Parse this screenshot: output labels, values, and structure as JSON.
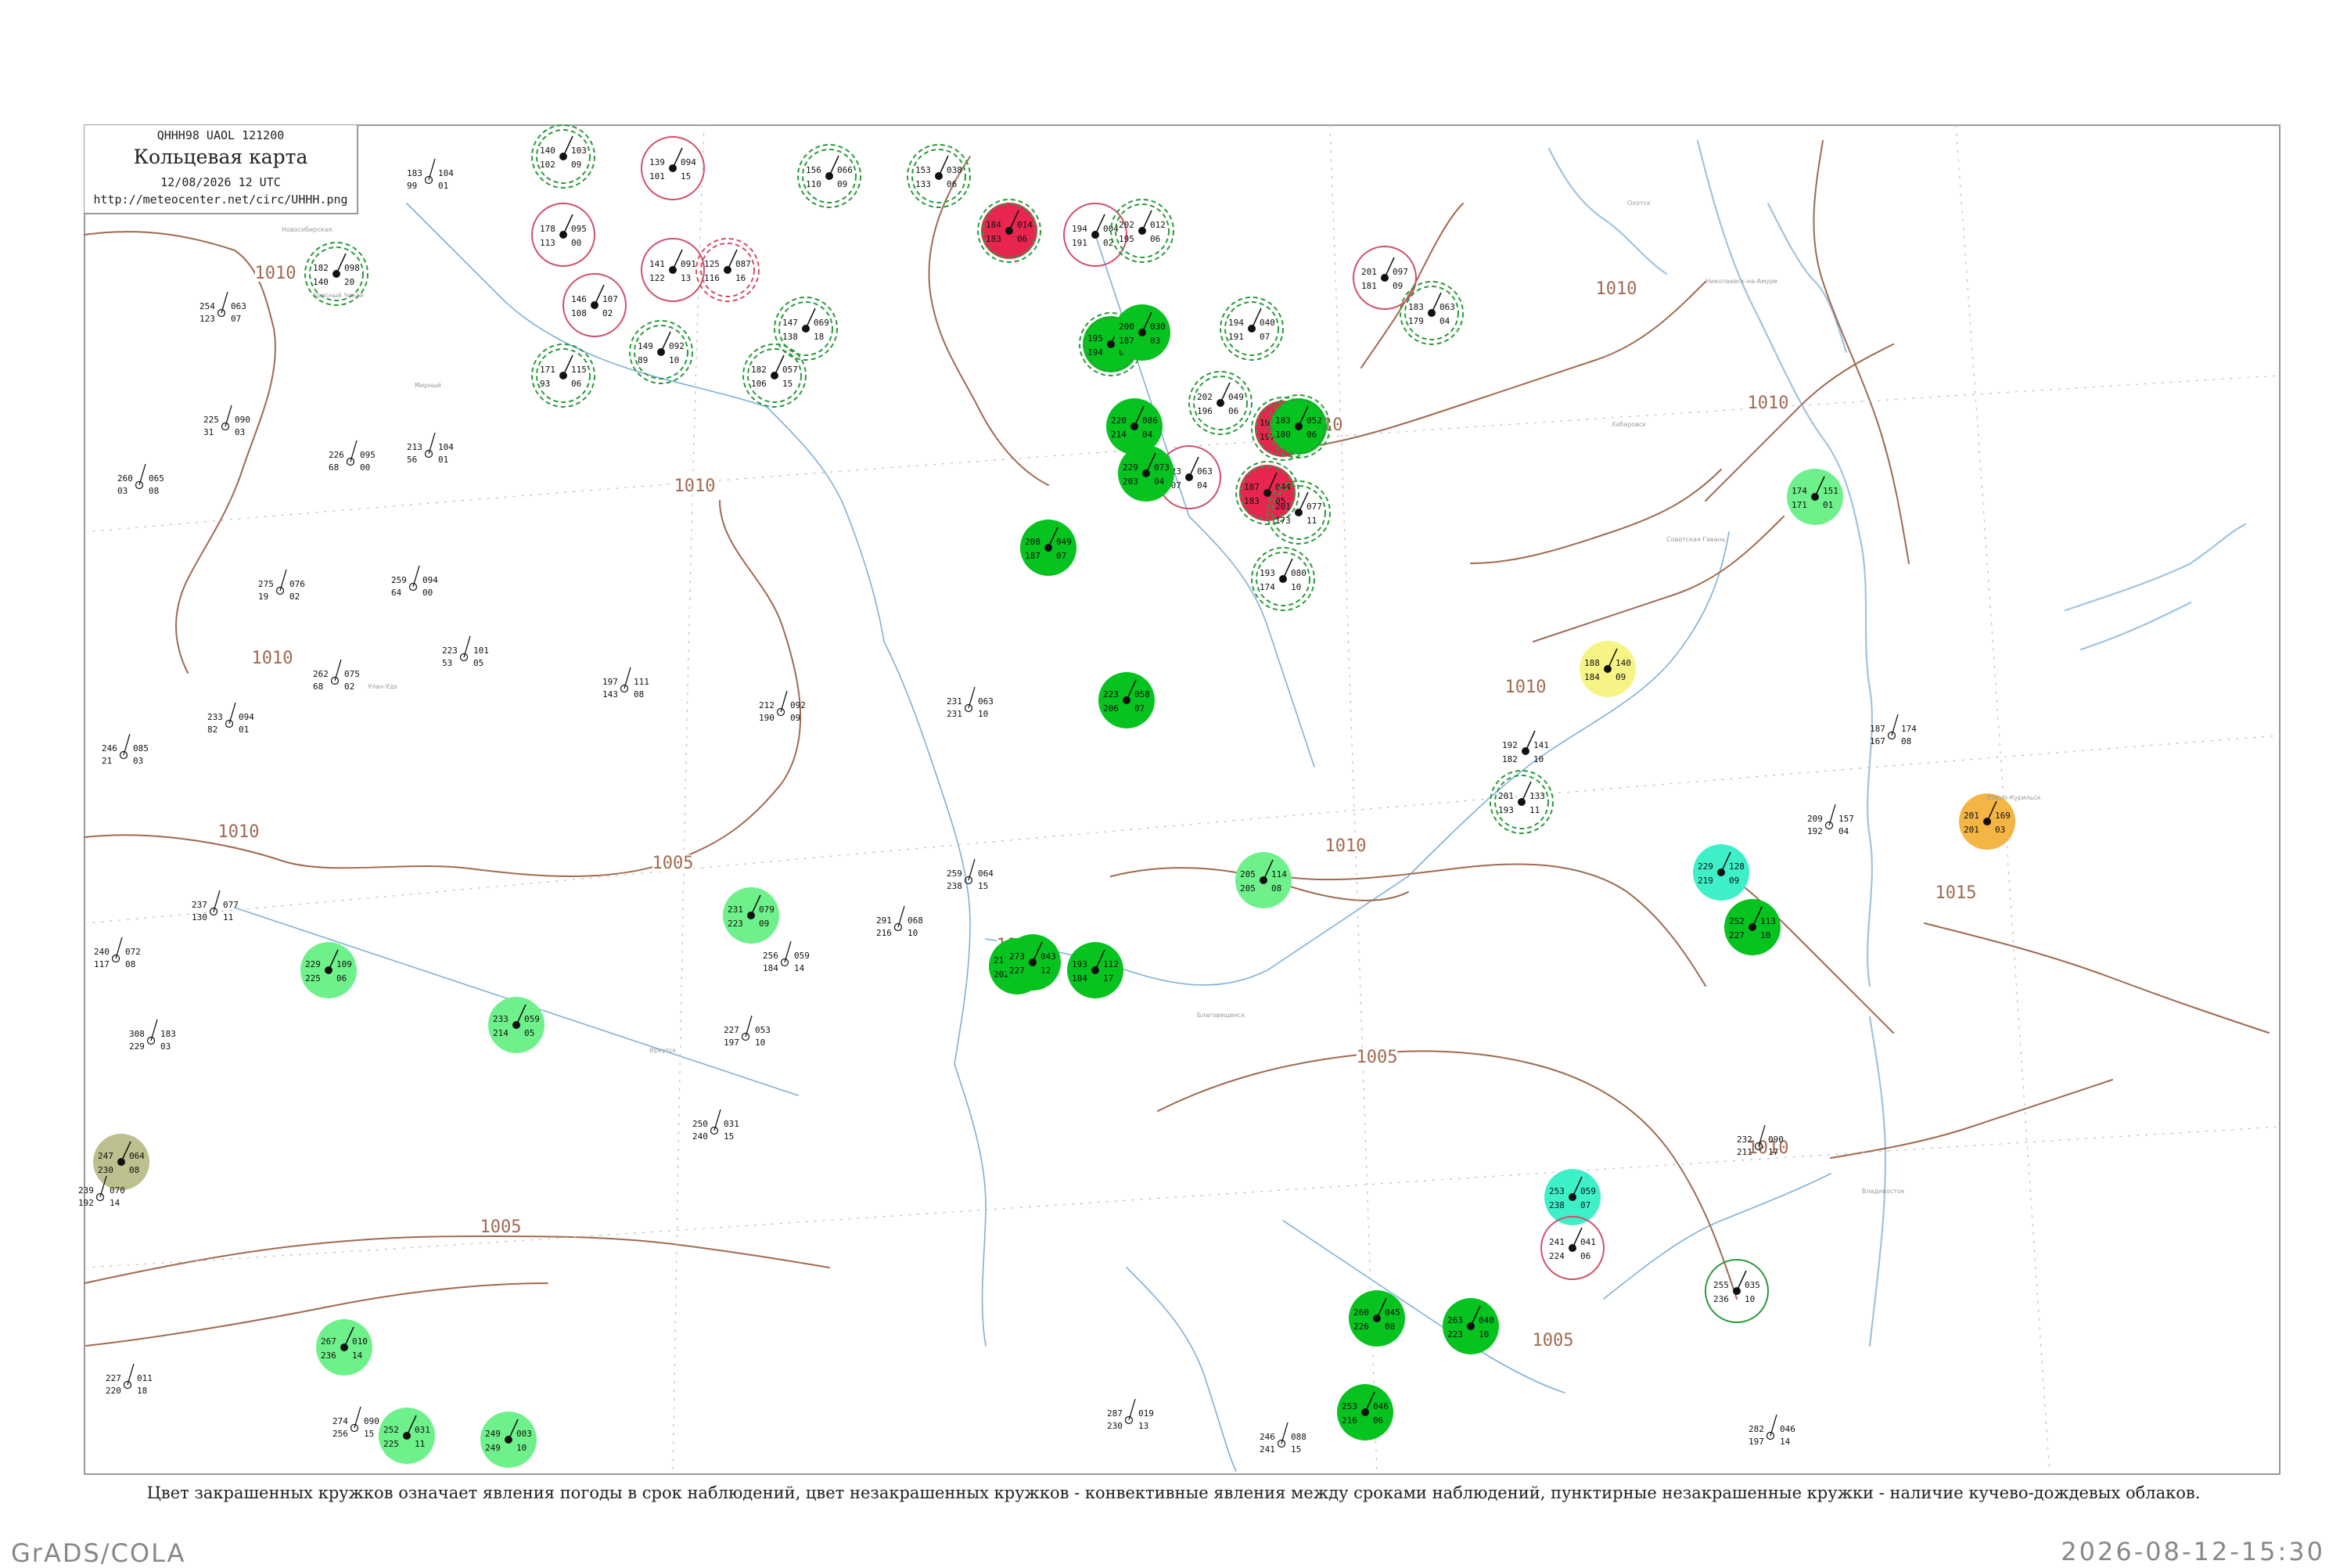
{
  "header": {
    "code": "QHHH98  UAOL  121200",
    "title": "Кольцевая карта",
    "datetime": "12/08/2026 12 UTC",
    "url": "http://meteocenter.net/circ/UHHH.png"
  },
  "caption": "Цвет закрашенных кружков означает явления погоды в срок наблюдений, цвет незакрашенных кружков - конвективные явления между сроками наблюдений, пунктирные незакрашенные кружки - наличие кучево-дождевых облаков.",
  "footer": {
    "left": "GrADS/COLA",
    "right": "2026-08-12-15:30"
  },
  "colors": {
    "precip_rain": "#06c31f",
    "precip_light": "#6ef08a",
    "thunder": "#e8254f",
    "fog": "#f7f486",
    "haze": "#f4b545",
    "drizzle_cyan": "#3ef0c8",
    "dust": "#bdbf8f",
    "isobar": "#a06a50",
    "river": "#7fb0d8",
    "coast": "#9fc4e0"
  },
  "isobars": [
    {
      "label": "1010"
    },
    {
      "label": "1010"
    },
    {
      "label": "1010"
    },
    {
      "label": "1010"
    },
    {
      "label": "1005"
    },
    {
      "label": "1005"
    },
    {
      "label": "1005"
    },
    {
      "label": "1010"
    },
    {
      "label": "1010"
    },
    {
      "label": "1010"
    },
    {
      "label": "1010"
    },
    {
      "label": "1010"
    },
    {
      "label": "1005"
    },
    {
      "label": "1010"
    },
    {
      "label": "1015"
    },
    {
      "label": "1005"
    }
  ],
  "stations": [
    {
      "temp": "182",
      "press": "098",
      "dew": "140",
      "tend": "20",
      "fill": "none",
      "ring": "green-dash"
    },
    {
      "temp": "140",
      "press": "103",
      "dew": "102",
      "tend": "09",
      "fill": "none",
      "ring": "green-dash"
    },
    {
      "temp": "178",
      "press": "095",
      "dew": "113",
      "tend": "00",
      "fill": "none",
      "ring": "red-solid"
    },
    {
      "temp": "139",
      "press": "094",
      "dew": "101",
      "tend": "15",
      "fill": "none",
      "ring": "red-solid"
    },
    {
      "temp": "146",
      "press": "107",
      "dew": "108",
      "tend": "02",
      "fill": "none",
      "ring": "red-solid"
    },
    {
      "temp": "141",
      "press": "091",
      "dew": "122",
      "tend": "13",
      "fill": "none",
      "ring": "red-solid"
    },
    {
      "temp": "125",
      "press": "087",
      "dew": "116",
      "tend": "16",
      "fill": "none",
      "ring": "red-dash"
    },
    {
      "temp": "171",
      "press": "115",
      "dew": "93",
      "tend": "06",
      "fill": "none",
      "ring": "green-dash"
    },
    {
      "temp": "149",
      "press": "092",
      "dew": "89",
      "tend": "10",
      "fill": "none",
      "ring": "green-dash"
    },
    {
      "temp": "147",
      "press": "069",
      "dew": "138",
      "tend": "18",
      "fill": "none",
      "ring": "green-dash"
    },
    {
      "temp": "182",
      "press": "057",
      "dew": "106",
      "tend": "15",
      "fill": "none",
      "ring": "green-dash"
    },
    {
      "temp": "156",
      "press": "066",
      "dew": "110",
      "tend": "09",
      "fill": "none",
      "ring": "green-dash"
    },
    {
      "temp": "153",
      "press": "038",
      "dew": "133",
      "tend": "06",
      "fill": "none",
      "ring": "green-dash"
    },
    {
      "temp": "184",
      "press": "014",
      "dew": "183",
      "tend": "06",
      "fill": "thunder",
      "ring": "green-dash"
    },
    {
      "temp": "194",
      "press": "004",
      "dew": "191",
      "tend": "02",
      "fill": "none",
      "ring": "red-solid"
    },
    {
      "temp": "202",
      "press": "012",
      "dew": "195",
      "tend": "06",
      "fill": "none",
      "ring": "green-dash"
    },
    {
      "temp": "195",
      "press": "036",
      "dew": "194",
      "tend": "07",
      "fill": "precip_rain",
      "ring": "green-dash"
    },
    {
      "temp": "200",
      "press": "030",
      "dew": "187",
      "tend": "03",
      "fill": "precip_rain",
      "ring": "none"
    },
    {
      "temp": "194",
      "press": "040",
      "dew": "191",
      "tend": "07",
      "fill": "none",
      "ring": "green-dash"
    },
    {
      "temp": "201",
      "press": "097",
      "dew": "181",
      "tend": "09",
      "fill": "none",
      "ring": "red-solid"
    },
    {
      "temp": "183",
      "press": "063",
      "dew": "179",
      "tend": "04",
      "fill": "none",
      "ring": "green-dash"
    },
    {
      "temp": "202",
      "press": "049",
      "dew": "196",
      "tend": "06",
      "fill": "none",
      "ring": "green-dash"
    },
    {
      "temp": "191",
      "press": "033",
      "dew": "197",
      "tend": "06",
      "fill": "thunder",
      "ring": "green-dash"
    },
    {
      "temp": "183",
      "press": "052",
      "dew": "180",
      "tend": "06",
      "fill": "precip_rain",
      "ring": "green-dash"
    },
    {
      "temp": "223",
      "press": "063",
      "dew": "207",
      "tend": "04",
      "fill": "none",
      "ring": "red-solid"
    },
    {
      "temp": "187",
      "press": "044",
      "dew": "183",
      "tend": "05",
      "fill": "thunder",
      "ring": "green-dash"
    },
    {
      "temp": "201",
      "press": "077",
      "dew": "173",
      "tend": "11",
      "fill": "none",
      "ring": "green-dash"
    },
    {
      "temp": "193",
      "press": "080",
      "dew": "174",
      "tend": "10",
      "fill": "none",
      "ring": "green-dash"
    },
    {
      "temp": "208",
      "press": "049",
      "dew": "187",
      "tend": "07",
      "fill": "precip_rain",
      "ring": "none"
    },
    {
      "temp": "188",
      "press": "140",
      "dew": "184",
      "tend": "09",
      "fill": "fog",
      "ring": "none"
    },
    {
      "temp": "174",
      "press": "151",
      "dew": "171",
      "tend": "01",
      "fill": "precip_light",
      "ring": "none"
    },
    {
      "temp": "201",
      "press": "169",
      "dew": "201",
      "tend": "03",
      "fill": "haze",
      "ring": "none"
    },
    {
      "temp": "201",
      "press": "133",
      "dew": "193",
      "tend": "11",
      "fill": "none",
      "ring": "green-dash"
    },
    {
      "temp": "192",
      "press": "141",
      "dew": "182",
      "tend": "10",
      "fill": "none",
      "ring": "none"
    },
    {
      "temp": "212",
      "press": "113",
      "dew": "202",
      "tend": "03",
      "fill": "precip_rain",
      "ring": "none"
    },
    {
      "temp": "193",
      "press": "112",
      "dew": "184",
      "tend": "17",
      "fill": "precip_rain",
      "ring": "none"
    },
    {
      "temp": "223",
      "press": "058",
      "dew": "206",
      "tend": "07",
      "fill": "precip_rain",
      "ring": "none"
    },
    {
      "temp": "229",
      "press": "073",
      "dew": "203",
      "tend": "04",
      "fill": "precip_rain",
      "ring": "none"
    },
    {
      "temp": "220",
      "press": "086",
      "dew": "214",
      "tend": "04",
      "fill": "precip_rain",
      "ring": "none"
    },
    {
      "temp": "231",
      "press": "079",
      "dew": "223",
      "tend": "09",
      "fill": "precip_light",
      "ring": "none"
    },
    {
      "temp": "229",
      "press": "109",
      "dew": "225",
      "tend": "06",
      "fill": "precip_light",
      "ring": "none"
    },
    {
      "temp": "233",
      "press": "059",
      "dew": "214",
      "tend": "05",
      "fill": "precip_light",
      "ring": "none"
    },
    {
      "temp": "205",
      "press": "114",
      "dew": "205",
      "tend": "08",
      "fill": "precip_light",
      "ring": "none"
    },
    {
      "temp": "229",
      "press": "128",
      "dew": "219",
      "tend": "09",
      "fill": "drizzle_cyan",
      "ring": "none"
    },
    {
      "temp": "252",
      "press": "113",
      "dew": "227",
      "tend": "10",
      "fill": "precip_rain",
      "ring": "none"
    },
    {
      "temp": "253",
      "press": "059",
      "dew": "238",
      "tend": "07",
      "fill": "drizzle_cyan",
      "ring": "none"
    },
    {
      "temp": "241",
      "press": "041",
      "dew": "224",
      "tend": "06",
      "fill": "none",
      "ring": "red-solid"
    },
    {
      "temp": "255",
      "press": "035",
      "dew": "236",
      "tend": "10",
      "fill": "none",
      "ring": "green-solid"
    },
    {
      "temp": "247",
      "press": "064",
      "dew": "230",
      "tend": "08",
      "fill": "dust",
      "ring": "none"
    },
    {
      "temp": "273",
      "press": "043",
      "dew": "227",
      "tend": "12",
      "fill": "precip_rain",
      "ring": "none"
    },
    {
      "temp": "267",
      "press": "010",
      "dew": "236",
      "tend": "14",
      "fill": "precip_light",
      "ring": "none"
    },
    {
      "temp": "252",
      "press": "031",
      "dew": "225",
      "tend": "11",
      "fill": "precip_light",
      "ring": "none"
    },
    {
      "temp": "249",
      "press": "003",
      "dew": "249",
      "tend": "10",
      "fill": "precip_light",
      "ring": "none"
    },
    {
      "temp": "253",
      "press": "046",
      "dew": "216",
      "tend": "06",
      "fill": "precip_rain",
      "ring": "none"
    },
    {
      "temp": "260",
      "press": "045",
      "dew": "226",
      "tend": "08",
      "fill": "precip_rain",
      "ring": "none"
    },
    {
      "temp": "263",
      "press": "040",
      "dew": "223",
      "tend": "10",
      "fill": "precip_rain",
      "ring": "none"
    }
  ],
  "plain_stations": [
    {
      "a": "183",
      "b": "104",
      "c": "99",
      "d": "01"
    },
    {
      "a": "254",
      "b": "063",
      "c": "123",
      "d": "07"
    },
    {
      "a": "225",
      "b": "090",
      "c": "31",
      "d": "03"
    },
    {
      "a": "260",
      "b": "065",
      "c": "03",
      "d": "08"
    },
    {
      "a": "275",
      "b": "076",
      "c": "19",
      "d": "02"
    },
    {
      "a": "262",
      "b": "075",
      "c": "68",
      "d": "02"
    },
    {
      "a": "233",
      "b": "094",
      "c": "82",
      "d": "01"
    },
    {
      "a": "246",
      "b": "085",
      "c": "21",
      "d": "03"
    },
    {
      "a": "237",
      "b": "077",
      "c": "130",
      "d": "11"
    },
    {
      "a": "240",
      "b": "072",
      "c": "117",
      "d": "08"
    },
    {
      "a": "308",
      "b": "183",
      "c": "229",
      "d": "03"
    },
    {
      "a": "239",
      "b": "070",
      "c": "192",
      "d": "14"
    },
    {
      "a": "227",
      "b": "011",
      "c": "220",
      "d": "18"
    },
    {
      "a": "274",
      "b": "090",
      "c": "256",
      "d": "15"
    },
    {
      "a": "226",
      "b": "095",
      "c": "68",
      "d": "00"
    },
    {
      "a": "213",
      "b": "104",
      "c": "56",
      "d": "01"
    },
    {
      "a": "259",
      "b": "094",
      "c": "64",
      "d": "00"
    },
    {
      "a": "223",
      "b": "101",
      "c": "53",
      "d": "05"
    },
    {
      "a": "197",
      "b": "111",
      "c": "143",
      "d": "08"
    },
    {
      "a": "212",
      "b": "092",
      "c": "190",
      "d": "09"
    },
    {
      "a": "231",
      "b": "063",
      "c": "231",
      "d": "10"
    },
    {
      "a": "259",
      "b": "064",
      "c": "238",
      "d": "15"
    },
    {
      "a": "291",
      "b": "068",
      "c": "216",
      "d": "10"
    },
    {
      "a": "256",
      "b": "059",
      "c": "184",
      "d": "14"
    },
    {
      "a": "227",
      "b": "053",
      "c": "197",
      "d": "10"
    },
    {
      "a": "250",
      "b": "031",
      "c": "240",
      "d": "15"
    },
    {
      "a": "287",
      "b": "019",
      "c": "230",
      "d": "13"
    },
    {
      "a": "246",
      "b": "088",
      "c": "241",
      "d": "15"
    },
    {
      "a": "282",
      "b": "046",
      "c": "197",
      "d": "14"
    },
    {
      "a": "232",
      "b": "090",
      "c": "211",
      "d": "17"
    },
    {
      "a": "209",
      "b": "157",
      "c": "192",
      "d": "04"
    },
    {
      "a": "187",
      "b": "174",
      "c": "167",
      "d": "08"
    }
  ],
  "place_labels": [
    "Новосибирская",
    "Красный Чикой",
    "Мирный",
    "Улан-Удэ",
    "Иркутск",
    "Благовещенск",
    "Хабаровск",
    "Владивосток",
    "Южно-Курильск",
    "Охотск",
    "Николаевск-на-Амуре",
    "Советская Гавань"
  ]
}
